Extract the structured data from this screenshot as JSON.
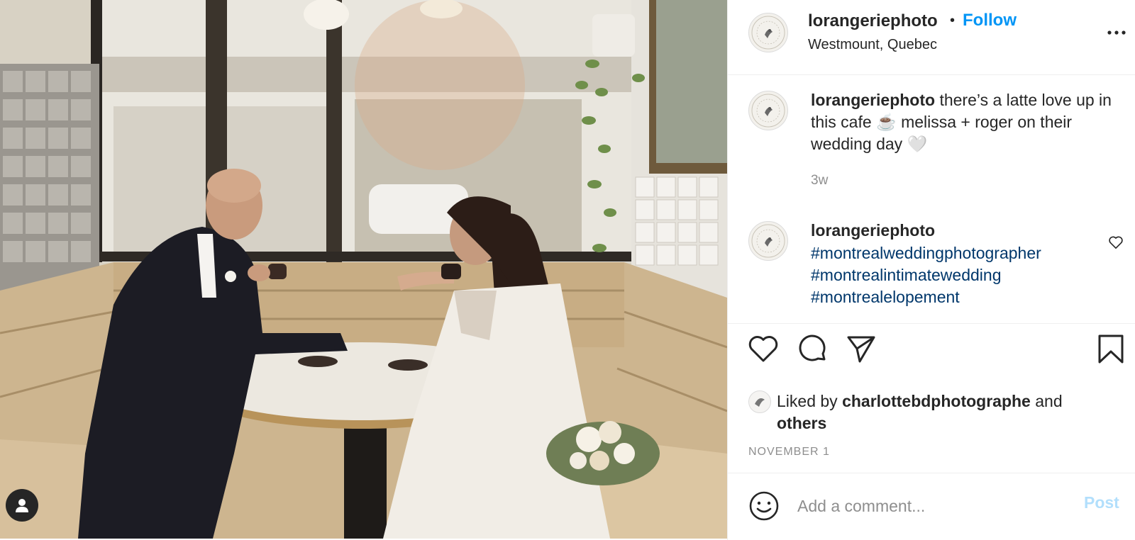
{
  "photo": {
    "alt": "Couple drinking coffee in a cafe booth",
    "tagged_icon": "user-icon"
  },
  "header": {
    "username": "lorangeriephoto",
    "separator": "•",
    "follow_label": "Follow",
    "location": "Westmount, Quebec",
    "more_icon": "more-options-icon"
  },
  "caption": {
    "username": "lorangeriephoto",
    "text": " there’s a latte love up in this cafe ☕️ melissa + roger on their wedding day 🤍",
    "time": "3w"
  },
  "comment": {
    "username": "lorangeriephoto",
    "tags": [
      "#montrealweddingphotographer",
      "#montrealintimatewedding",
      "#montrealelopement"
    ]
  },
  "actions": {
    "icons": [
      "heart-icon",
      "comment-icon",
      "share-icon",
      "bookmark-icon"
    ]
  },
  "likes": {
    "prefix": "Liked by ",
    "user": "charlottebdphotographe",
    "middle": " and",
    "others": "others"
  },
  "date": "NOVEMBER 1",
  "add_comment": {
    "placeholder": "Add a comment...",
    "post_label": "Post"
  },
  "colors": {
    "follow": "#0095f6",
    "hashtag": "#00376b",
    "muted": "#8e8e8e",
    "post_disabled": "#b2dffc"
  }
}
